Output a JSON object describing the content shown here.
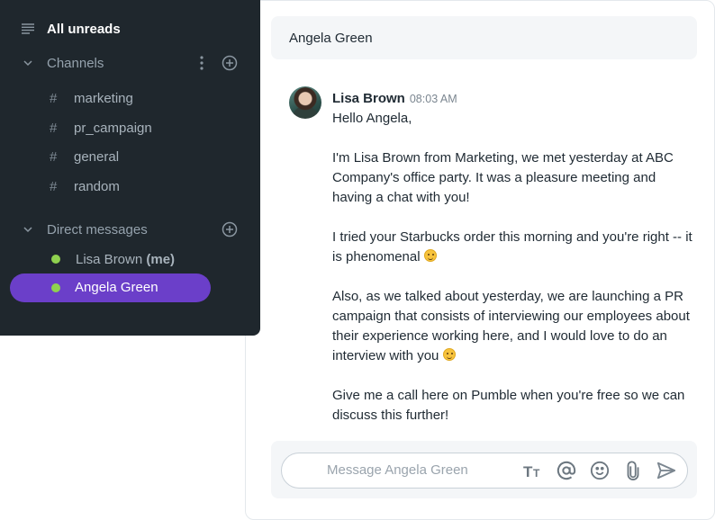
{
  "sidebar": {
    "all_unreads": "All unreads",
    "channels_header": "Channels",
    "channels": [
      {
        "name": "marketing"
      },
      {
        "name": "pr_campaign"
      },
      {
        "name": "general"
      },
      {
        "name": "random"
      }
    ],
    "dm_header": "Direct messages",
    "dms": [
      {
        "name": "Lisa Brown",
        "suffix": "(me)"
      },
      {
        "name": "Angela Green"
      }
    ],
    "hash_symbol": "#",
    "accent_color": "#6b3fc9",
    "online_color": "#8fd14f"
  },
  "chat": {
    "title": "Angela Green",
    "message": {
      "author": "Lisa Brown",
      "time": "08:03 AM",
      "paragraphs": [
        "Hello Angela,",
        "I'm Lisa Brown from Marketing, we met yesterday at ABC Company's office party. It was a pleasure meeting and having a chat with you!",
        "I tried your Starbucks order this morning and you're right -- it is phenomenal",
        "Also, as we talked about yesterday, we are launching a PR campaign that consists of interviewing our employees about their experience working here, and I would love to do an interview with you",
        "Give me a call here on Pumble when you're free so we can discuss this further!"
      ]
    },
    "composer": {
      "placeholder": "Message Angela Green",
      "value": ""
    }
  },
  "icons": {
    "menu": "list-icon",
    "chevron": "chevron-down-icon",
    "more": "kebab-icon",
    "add": "plus-circle-icon",
    "format": "text-format-icon",
    "mention": "at-icon",
    "emoji": "emoji-icon",
    "attach": "paperclip-icon",
    "send": "send-icon"
  }
}
